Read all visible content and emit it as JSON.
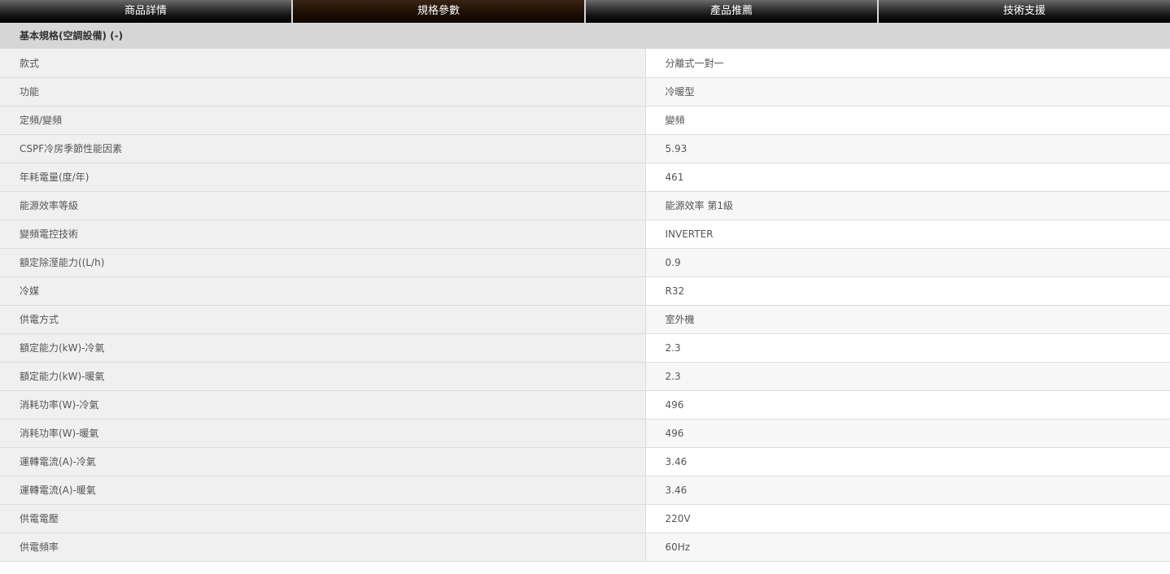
{
  "tabs": [
    {
      "label": "商品詳情"
    },
    {
      "label": "規格參數"
    },
    {
      "label": "產品推薦"
    },
    {
      "label": "技術支援"
    }
  ],
  "active_tab": "規格參數",
  "section": {
    "title": "基本規格(空調設備) (-)"
  },
  "specs": [
    {
      "label": "款式",
      "value": "分離式一對一"
    },
    {
      "label": "功能",
      "value": "冷暖型"
    },
    {
      "label": "定頻/變頻",
      "value": "變頻"
    },
    {
      "label": "CSPF冷房季節性能因素",
      "value": "5.93"
    },
    {
      "label": "年耗電量(度/年)",
      "value": "461"
    },
    {
      "label": "能源效率等級",
      "value": "能源效率 第1級"
    },
    {
      "label": "變頻電控技術",
      "value": "INVERTER"
    },
    {
      "label": "額定除溼能力((L/h)",
      "value": "0.9"
    },
    {
      "label": "冷媒",
      "value": "R32"
    },
    {
      "label": "供電方式",
      "value": "室外機"
    },
    {
      "label": "額定能力(kW)-冷氣",
      "value": "2.3"
    },
    {
      "label": "額定能力(kW)-暖氣",
      "value": "2.3"
    },
    {
      "label": "消耗功率(W)-冷氣",
      "value": "496"
    },
    {
      "label": "消耗功率(W)-暖氣",
      "value": "496"
    },
    {
      "label": "運轉電流(A)-冷氣",
      "value": "3.46"
    },
    {
      "label": "運轉電流(A)-暖氣",
      "value": "3.46"
    },
    {
      "label": "供電電壓",
      "value": "220V"
    },
    {
      "label": "供電頻率",
      "value": "60Hz"
    }
  ],
  "colors": {
    "tab_active": "#1f1006",
    "section_header_bg": "#d6d6d6",
    "label_bg": "#f0f0f0"
  }
}
